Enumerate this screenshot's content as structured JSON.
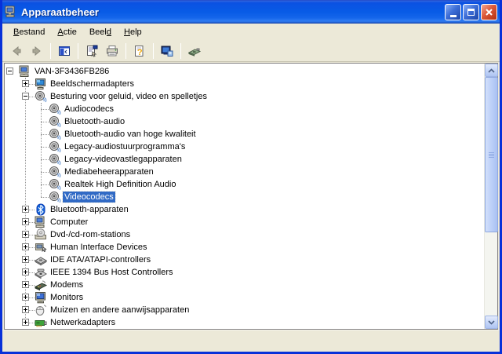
{
  "window": {
    "title": "Apparaatbeheer",
    "app_icon": "device-manager-computer-icon",
    "controls": [
      {
        "name": "minimize-button"
      },
      {
        "name": "maximize-button"
      },
      {
        "name": "close-button"
      }
    ]
  },
  "menu": {
    "items": [
      {
        "label": "Bestand",
        "underline": 0
      },
      {
        "label": "Actie",
        "underline": 0
      },
      {
        "label": "Beeld",
        "underline": 4
      },
      {
        "label": "Help",
        "underline": 0
      }
    ]
  },
  "toolbar": {
    "items": [
      {
        "icon": "back-icon",
        "disabled": true
      },
      {
        "icon": "forward-icon",
        "disabled": true
      },
      {
        "sep": true
      },
      {
        "icon": "show-console-tree-icon"
      },
      {
        "sep": true
      },
      {
        "icon": "properties-icon"
      },
      {
        "icon": "print-icon"
      },
      {
        "sep": true
      },
      {
        "icon": "help-icon"
      },
      {
        "sep": true
      },
      {
        "icon": "update-driver-icon"
      },
      {
        "sep": true
      },
      {
        "icon": "scan-hardware-icon"
      }
    ]
  },
  "tree": {
    "items": [
      {
        "label": "VAN-3F3436FB286",
        "level": 0,
        "expander": "minus",
        "icon": "computer-icon"
      },
      {
        "label": "Beeldschermadapters",
        "level": 1,
        "expander": "plus",
        "icon": "display-adapter-icon"
      },
      {
        "label": "Besturing voor geluid, video en spelletjes",
        "level": 1,
        "expander": "minus",
        "icon": "speaker-icon"
      },
      {
        "label": "Audiocodecs",
        "level": 2,
        "icon": "speaker-icon"
      },
      {
        "label": "Bluetooth-audio",
        "level": 2,
        "icon": "speaker-icon"
      },
      {
        "label": "Bluetooth-audio van hoge kwaliteit",
        "level": 2,
        "icon": "speaker-icon"
      },
      {
        "label": "Legacy-audiostuurprogramma's",
        "level": 2,
        "icon": "speaker-icon"
      },
      {
        "label": "Legacy-videovastlegapparaten",
        "level": 2,
        "icon": "speaker-icon"
      },
      {
        "label": "Mediabeheerapparaten",
        "level": 2,
        "icon": "speaker-icon"
      },
      {
        "label": "Realtek High Definition Audio",
        "level": 2,
        "icon": "speaker-icon"
      },
      {
        "label": "Videocodecs",
        "level": 2,
        "icon": "speaker-icon",
        "selected": true
      },
      {
        "label": "Bluetooth-apparaten",
        "level": 1,
        "expander": "plus",
        "icon": "bluetooth-icon"
      },
      {
        "label": "Computer",
        "level": 1,
        "expander": "plus",
        "icon": "computer-icon"
      },
      {
        "label": "Dvd-/cd-rom-stations",
        "level": 1,
        "expander": "plus",
        "icon": "cdrom-icon"
      },
      {
        "label": "Human Interface Devices",
        "level": 1,
        "expander": "plus",
        "icon": "hid-icon"
      },
      {
        "label": "IDE ATA/ATAPI-controllers",
        "level": 1,
        "expander": "plus",
        "icon": "ide-controller-icon"
      },
      {
        "label": "IEEE 1394 Bus Host Controllers",
        "level": 1,
        "expander": "plus",
        "icon": "ieee1394-icon"
      },
      {
        "label": "Modems",
        "level": 1,
        "expander": "plus",
        "icon": "modem-icon"
      },
      {
        "label": "Monitors",
        "level": 1,
        "expander": "plus",
        "icon": "monitor-icon"
      },
      {
        "label": "Muizen en andere aanwijsapparaten",
        "level": 1,
        "expander": "plus",
        "icon": "mouse-icon"
      },
      {
        "label": "Netwerkadapters",
        "level": 1,
        "expander": "plus",
        "icon": "network-adapter-icon"
      }
    ]
  },
  "colors": {
    "selection": "#316AC5",
    "titlebar_blue": "#0855DD",
    "window_border": "#0831D9",
    "close_red": "#DD5A3A",
    "chrome_beige": "#ECE9D8"
  }
}
